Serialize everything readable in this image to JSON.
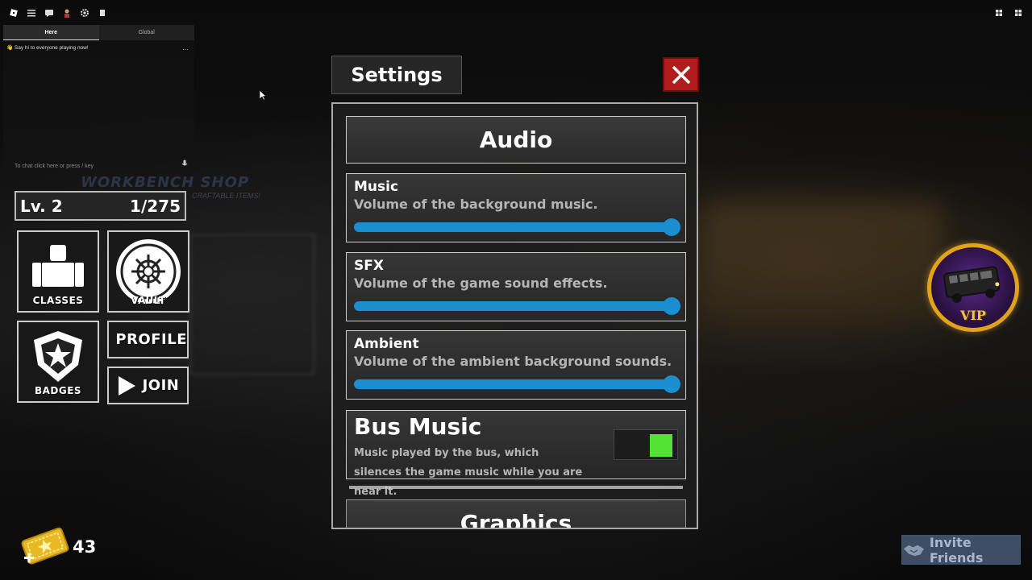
{
  "background": {
    "shop_sign": "WORKBENCH SHOP",
    "shop_sub": "CRAFTABLE ITEMS!"
  },
  "topbar": {
    "icons": [
      "roblox-logo-icon",
      "menu-icon",
      "chat-icon",
      "avatar-icon",
      "gear-icon",
      "leaderboard-icon"
    ],
    "right_icons": [
      "backpack-icon",
      "more-icon"
    ]
  },
  "chat": {
    "tabs": [
      "Here",
      "Global"
    ],
    "active_tab": "Here",
    "message": "👋 Say hi to everyone playing now!",
    "input_placeholder": "To chat click here or press / key"
  },
  "player": {
    "level": "Lv. 2",
    "xp": "1/275"
  },
  "menu": {
    "classes": "CLASSES",
    "vault": "VAULT",
    "badges": "BADGES",
    "profile": "PROFILE",
    "join": "JOIN"
  },
  "currency": {
    "tickets": "43"
  },
  "settings": {
    "title": "Settings",
    "sections": {
      "audio": "Audio",
      "graphics": "Graphics"
    },
    "sliders": [
      {
        "name": "Music",
        "desc": "Volume of the background music.",
        "value": 1.0
      },
      {
        "name": "SFX",
        "desc": "Volume of the game sound effects.",
        "value": 1.0
      },
      {
        "name": "Ambient",
        "desc": "Volume of the ambient background sounds.",
        "value": 1.0
      }
    ],
    "bus_music": {
      "name": "Bus Music",
      "desc": "Music played by the bus, which silences the game music while you are near it.",
      "enabled": true
    }
  },
  "vip": {
    "label": "VIP"
  },
  "invite": {
    "label": "Invite Friends"
  },
  "colors": {
    "slider": "#1a8ecf",
    "toggle_on": "#52e334",
    "close": "#b11d1d",
    "vip_gold": "#e0a31a"
  }
}
